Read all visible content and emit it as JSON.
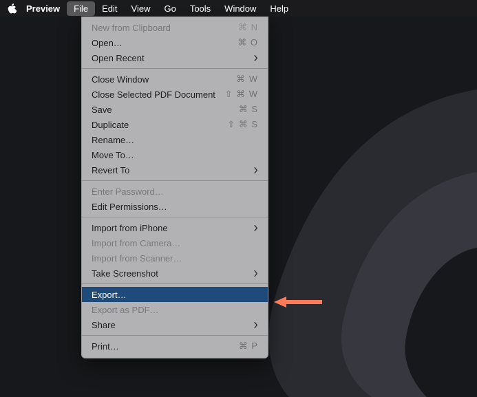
{
  "menubar": {
    "app": "Preview",
    "items": [
      "File",
      "Edit",
      "View",
      "Go",
      "Tools",
      "Window",
      "Help"
    ],
    "open_index": 0
  },
  "dropdown": {
    "groups": [
      [
        {
          "label": "New from Clipboard",
          "shortcut": "⌘ N",
          "disabled": true
        },
        {
          "label": "Open…",
          "shortcut": "⌘ O"
        },
        {
          "label": "Open Recent",
          "submenu": true
        }
      ],
      [
        {
          "label": "Close Window",
          "shortcut": "⌘ W"
        },
        {
          "label": "Close Selected PDF Document",
          "shortcut": "⇧ ⌘ W"
        },
        {
          "label": "Save",
          "shortcut": "⌘ S"
        },
        {
          "label": "Duplicate",
          "shortcut": "⇧ ⌘ S"
        },
        {
          "label": "Rename…"
        },
        {
          "label": "Move To…"
        },
        {
          "label": "Revert To",
          "submenu": true
        }
      ],
      [
        {
          "label": "Enter Password…",
          "disabled": true
        },
        {
          "label": "Edit Permissions…"
        }
      ],
      [
        {
          "label": "Import from iPhone",
          "submenu": true
        },
        {
          "label": "Import from Camera…",
          "disabled": true
        },
        {
          "label": "Import from Scanner…",
          "disabled": true
        },
        {
          "label": "Take Screenshot",
          "submenu": true
        }
      ],
      [
        {
          "label": "Export…",
          "selected": true
        },
        {
          "label": "Export as PDF…",
          "disabled": true
        },
        {
          "label": "Share",
          "submenu": true
        }
      ],
      [
        {
          "label": "Print…",
          "shortcut": "⌘ P"
        }
      ]
    ]
  },
  "colors": {
    "highlight": "#1f4b7a",
    "arrow": "#ff7a59"
  },
  "annotation": {
    "arrow_points_to": "Export…"
  }
}
